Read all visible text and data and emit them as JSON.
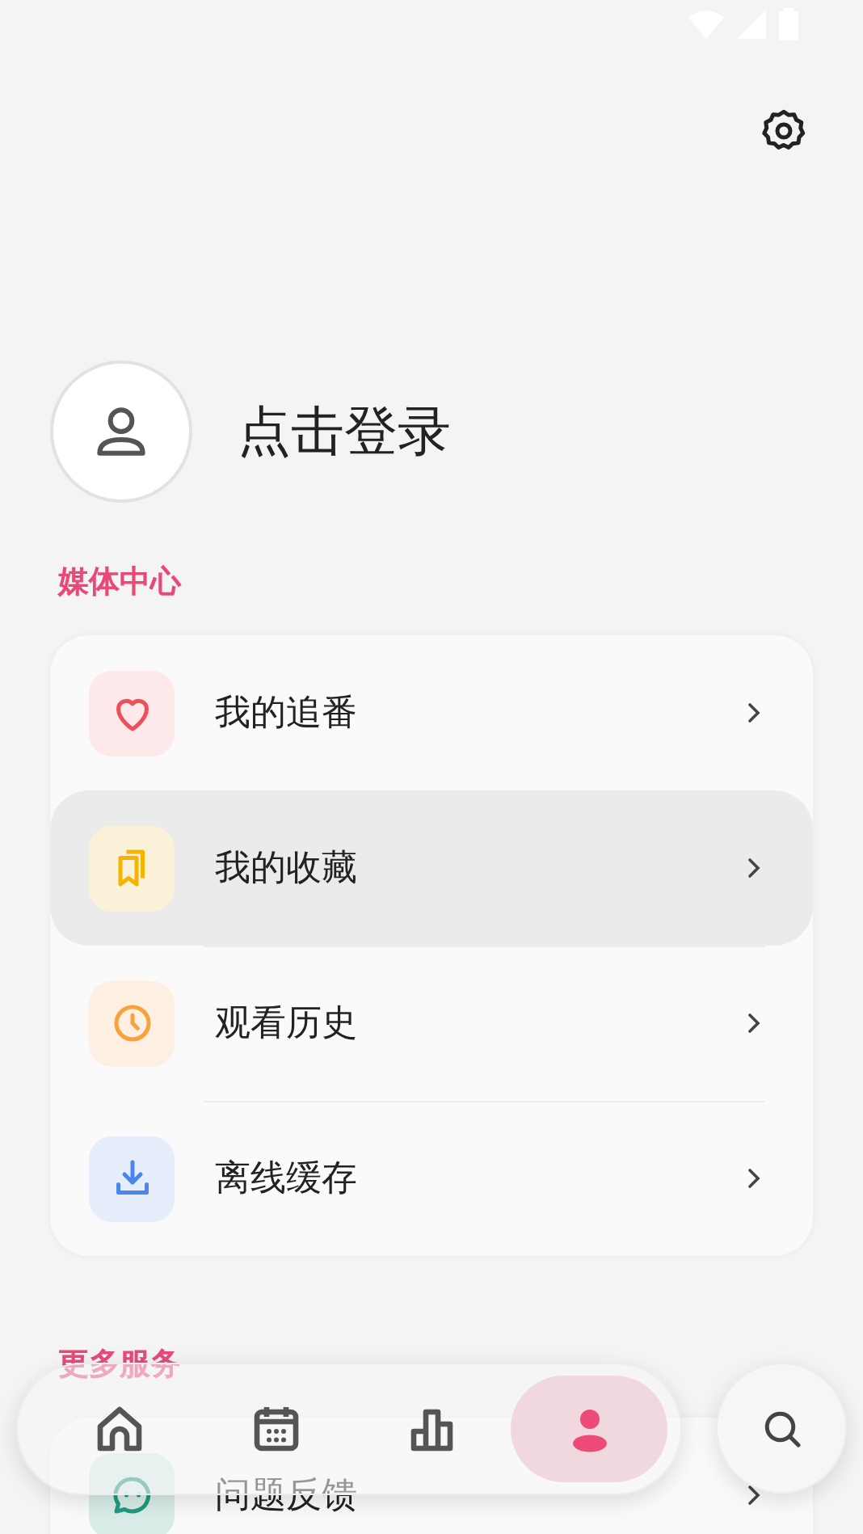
{
  "profile": {
    "login_label": "点击登录"
  },
  "sections": [
    {
      "title": "媒体中心",
      "items": [
        {
          "kind": "heart",
          "label": "我的追番",
          "selected": false
        },
        {
          "kind": "bookmark",
          "label": "我的收藏",
          "selected": true
        },
        {
          "kind": "clock",
          "label": "观看历史",
          "selected": false
        },
        {
          "kind": "download",
          "label": "离线缓存",
          "selected": false
        }
      ]
    },
    {
      "title": "更多服务",
      "items": [
        {
          "kind": "chat",
          "label": "问题反馈",
          "selected": false
        }
      ]
    }
  ],
  "bottom_nav": {
    "items": [
      {
        "kind": "home",
        "selected": false
      },
      {
        "kind": "calendar",
        "selected": false
      },
      {
        "kind": "chart",
        "selected": false
      },
      {
        "kind": "person",
        "selected": true
      }
    ]
  }
}
